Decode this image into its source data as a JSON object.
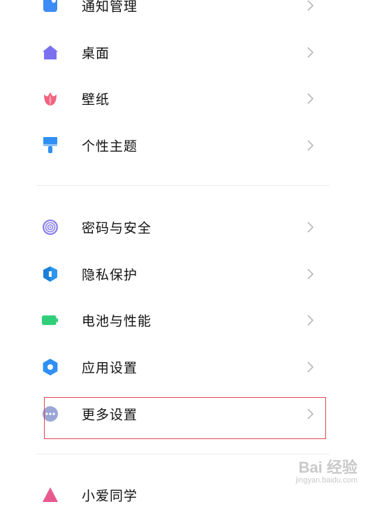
{
  "settings": {
    "group1": [
      {
        "label": "通知管理",
        "icon": "notification-icon",
        "color": "#3d8bf6"
      },
      {
        "label": "桌面",
        "icon": "home-icon",
        "color": "#7b71f0"
      },
      {
        "label": "壁纸",
        "icon": "tulip-icon",
        "color": "#f06480"
      },
      {
        "label": "个性主题",
        "icon": "paintbrush-icon",
        "color": "#2f8ff5"
      }
    ],
    "group2": [
      {
        "label": "密码与安全",
        "icon": "fingerprint-icon",
        "color": "#8a7ff0"
      },
      {
        "label": "隐私保护",
        "icon": "shield-icon",
        "color": "#2b95ef"
      },
      {
        "label": "电池与性能",
        "icon": "battery-icon",
        "color": "#2fcf79"
      },
      {
        "label": "应用设置",
        "icon": "gear-icon",
        "color": "#2f8ff5"
      },
      {
        "label": "更多设置",
        "icon": "more-dots-icon",
        "color": "#9aa6d6"
      }
    ],
    "group3": [
      {
        "label": "小爱同学",
        "icon": "xiaoai-icon",
        "color": "#e85a8f"
      }
    ]
  },
  "watermark": {
    "main": "Bai 经验",
    "sub": "jingyan.baidu.com"
  }
}
